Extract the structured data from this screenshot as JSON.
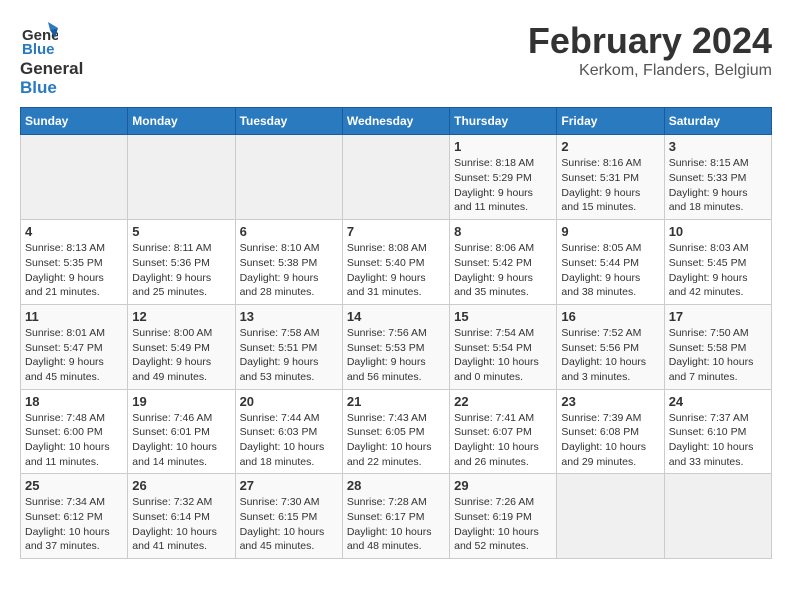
{
  "logo": {
    "line1": "General",
    "line2": "Blue"
  },
  "title": "February 2024",
  "subtitle": "Kerkom, Flanders, Belgium",
  "days_of_week": [
    "Sunday",
    "Monday",
    "Tuesday",
    "Wednesday",
    "Thursday",
    "Friday",
    "Saturday"
  ],
  "weeks": [
    [
      {
        "day": "",
        "info": ""
      },
      {
        "day": "",
        "info": ""
      },
      {
        "day": "",
        "info": ""
      },
      {
        "day": "",
        "info": ""
      },
      {
        "day": "1",
        "info": "Sunrise: 8:18 AM\nSunset: 5:29 PM\nDaylight: 9 hours\nand 11 minutes."
      },
      {
        "day": "2",
        "info": "Sunrise: 8:16 AM\nSunset: 5:31 PM\nDaylight: 9 hours\nand 15 minutes."
      },
      {
        "day": "3",
        "info": "Sunrise: 8:15 AM\nSunset: 5:33 PM\nDaylight: 9 hours\nand 18 minutes."
      }
    ],
    [
      {
        "day": "4",
        "info": "Sunrise: 8:13 AM\nSunset: 5:35 PM\nDaylight: 9 hours\nand 21 minutes."
      },
      {
        "day": "5",
        "info": "Sunrise: 8:11 AM\nSunset: 5:36 PM\nDaylight: 9 hours\nand 25 minutes."
      },
      {
        "day": "6",
        "info": "Sunrise: 8:10 AM\nSunset: 5:38 PM\nDaylight: 9 hours\nand 28 minutes."
      },
      {
        "day": "7",
        "info": "Sunrise: 8:08 AM\nSunset: 5:40 PM\nDaylight: 9 hours\nand 31 minutes."
      },
      {
        "day": "8",
        "info": "Sunrise: 8:06 AM\nSunset: 5:42 PM\nDaylight: 9 hours\nand 35 minutes."
      },
      {
        "day": "9",
        "info": "Sunrise: 8:05 AM\nSunset: 5:44 PM\nDaylight: 9 hours\nand 38 minutes."
      },
      {
        "day": "10",
        "info": "Sunrise: 8:03 AM\nSunset: 5:45 PM\nDaylight: 9 hours\nand 42 minutes."
      }
    ],
    [
      {
        "day": "11",
        "info": "Sunrise: 8:01 AM\nSunset: 5:47 PM\nDaylight: 9 hours\nand 45 minutes."
      },
      {
        "day": "12",
        "info": "Sunrise: 8:00 AM\nSunset: 5:49 PM\nDaylight: 9 hours\nand 49 minutes."
      },
      {
        "day": "13",
        "info": "Sunrise: 7:58 AM\nSunset: 5:51 PM\nDaylight: 9 hours\nand 53 minutes."
      },
      {
        "day": "14",
        "info": "Sunrise: 7:56 AM\nSunset: 5:53 PM\nDaylight: 9 hours\nand 56 minutes."
      },
      {
        "day": "15",
        "info": "Sunrise: 7:54 AM\nSunset: 5:54 PM\nDaylight: 10 hours\nand 0 minutes."
      },
      {
        "day": "16",
        "info": "Sunrise: 7:52 AM\nSunset: 5:56 PM\nDaylight: 10 hours\nand 3 minutes."
      },
      {
        "day": "17",
        "info": "Sunrise: 7:50 AM\nSunset: 5:58 PM\nDaylight: 10 hours\nand 7 minutes."
      }
    ],
    [
      {
        "day": "18",
        "info": "Sunrise: 7:48 AM\nSunset: 6:00 PM\nDaylight: 10 hours\nand 11 minutes."
      },
      {
        "day": "19",
        "info": "Sunrise: 7:46 AM\nSunset: 6:01 PM\nDaylight: 10 hours\nand 14 minutes."
      },
      {
        "day": "20",
        "info": "Sunrise: 7:44 AM\nSunset: 6:03 PM\nDaylight: 10 hours\nand 18 minutes."
      },
      {
        "day": "21",
        "info": "Sunrise: 7:43 AM\nSunset: 6:05 PM\nDaylight: 10 hours\nand 22 minutes."
      },
      {
        "day": "22",
        "info": "Sunrise: 7:41 AM\nSunset: 6:07 PM\nDaylight: 10 hours\nand 26 minutes."
      },
      {
        "day": "23",
        "info": "Sunrise: 7:39 AM\nSunset: 6:08 PM\nDaylight: 10 hours\nand 29 minutes."
      },
      {
        "day": "24",
        "info": "Sunrise: 7:37 AM\nSunset: 6:10 PM\nDaylight: 10 hours\nand 33 minutes."
      }
    ],
    [
      {
        "day": "25",
        "info": "Sunrise: 7:34 AM\nSunset: 6:12 PM\nDaylight: 10 hours\nand 37 minutes."
      },
      {
        "day": "26",
        "info": "Sunrise: 7:32 AM\nSunset: 6:14 PM\nDaylight: 10 hours\nand 41 minutes."
      },
      {
        "day": "27",
        "info": "Sunrise: 7:30 AM\nSunset: 6:15 PM\nDaylight: 10 hours\nand 45 minutes."
      },
      {
        "day": "28",
        "info": "Sunrise: 7:28 AM\nSunset: 6:17 PM\nDaylight: 10 hours\nand 48 minutes."
      },
      {
        "day": "29",
        "info": "Sunrise: 7:26 AM\nSunset: 6:19 PM\nDaylight: 10 hours\nand 52 minutes."
      },
      {
        "day": "",
        "info": ""
      },
      {
        "day": "",
        "info": ""
      }
    ]
  ]
}
